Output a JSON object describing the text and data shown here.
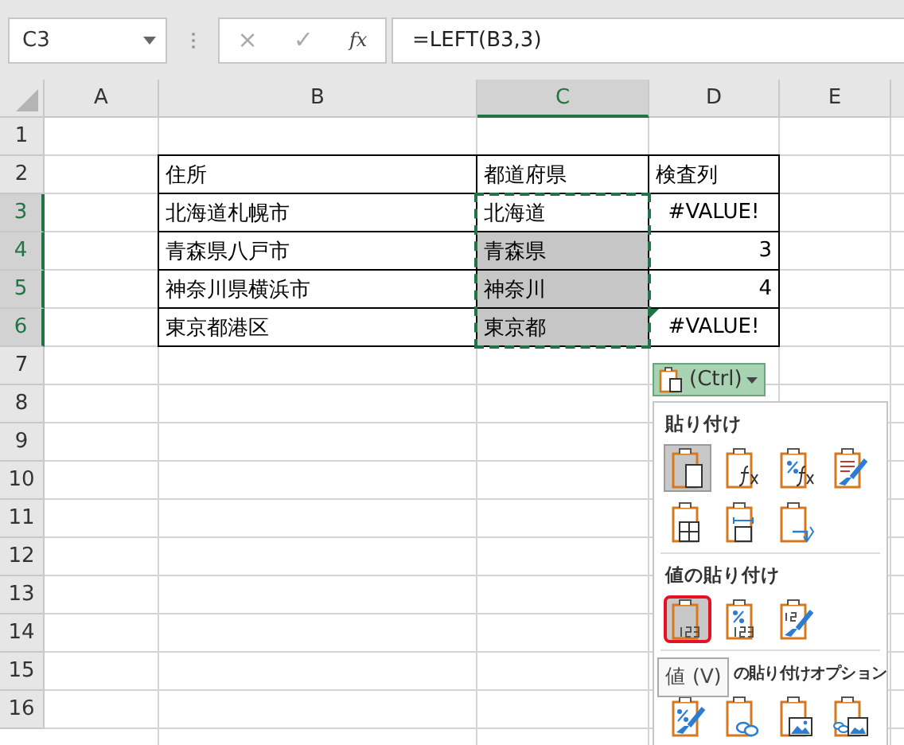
{
  "name_box": "C3",
  "formula_bar": {
    "cancel": "×",
    "enter": "✓",
    "function": "fx",
    "formula": "=LEFT(B3,3)"
  },
  "columns": [
    {
      "label": "A",
      "selected": false
    },
    {
      "label": "B",
      "selected": false
    },
    {
      "label": "C",
      "selected": true
    },
    {
      "label": "D",
      "selected": false
    },
    {
      "label": "E",
      "selected": false
    }
  ],
  "header_row": {
    "row": "2",
    "cells": [
      "住所",
      "都道府県",
      "検査列"
    ]
  },
  "data_rows": [
    {
      "row": "3",
      "selected": true,
      "address": "北海道札幌市",
      "prefecture": "北海道",
      "prefecture_highlighted": false,
      "check": "#VALUE!",
      "kind": "error",
      "error_marker": false
    },
    {
      "row": "4",
      "selected": true,
      "address": "青森県八戸市",
      "prefecture": "青森県",
      "prefecture_highlighted": true,
      "check": "3",
      "kind": "number",
      "error_marker": false
    },
    {
      "row": "5",
      "selected": true,
      "address": "神奈川県横浜市",
      "prefecture": "神奈川",
      "prefecture_highlighted": true,
      "check": "4",
      "kind": "number",
      "error_marker": false
    },
    {
      "row": "6",
      "selected": true,
      "address": "東京都港区",
      "prefecture": "東京都",
      "prefecture_highlighted": true,
      "check": "#VALUE!",
      "kind": "error",
      "error_marker": true
    }
  ],
  "empty_rows": [
    "1",
    "7",
    "8",
    "9",
    "10",
    "11",
    "12",
    "13",
    "14",
    "15",
    "16"
  ],
  "paste_button": {
    "label": "(Ctrl)"
  },
  "paste_menu": [
    {
      "title": "貼り付け",
      "items": [
        {
          "kind": "paste",
          "selected": true,
          "hovered": false
        },
        {
          "kind": "formula",
          "selected": false,
          "hovered": false
        },
        {
          "kind": "formula-format",
          "selected": false,
          "hovered": false
        },
        {
          "kind": "source-format",
          "selected": false,
          "hovered": false
        },
        {
          "kind": "no-borders",
          "selected": false,
          "hovered": false
        },
        {
          "kind": "column-width",
          "selected": false,
          "hovered": false
        },
        {
          "kind": "transpose",
          "selected": false,
          "hovered": false
        }
      ]
    },
    {
      "title": "値の貼り付け",
      "items": [
        {
          "kind": "values",
          "selected": true,
          "hovered": true
        },
        {
          "kind": "values-format",
          "selected": false,
          "hovered": false
        },
        {
          "kind": "values-source",
          "selected": false,
          "hovered": false
        }
      ]
    },
    {
      "title": "の貼り付けオプション",
      "items": [
        {
          "kind": "formatting",
          "selected": false,
          "hovered": false
        },
        {
          "kind": "link",
          "selected": false,
          "hovered": false
        },
        {
          "kind": "picture",
          "selected": false,
          "hovered": false
        },
        {
          "kind": "linked-picture",
          "selected": false,
          "hovered": false
        }
      ]
    }
  ],
  "tooltip": "値 (V)"
}
